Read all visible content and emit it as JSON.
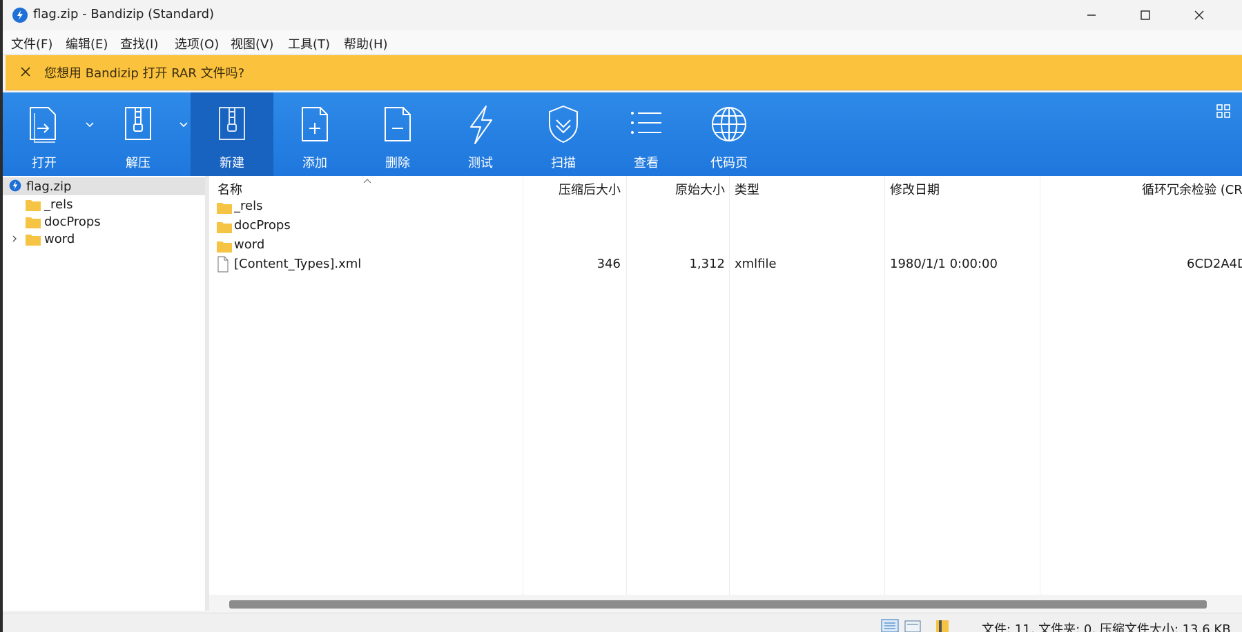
{
  "window": {
    "title": "flag.zip - Bandizip (Standard)"
  },
  "menu": [
    "文件(F)",
    "编辑(E)",
    "查找(I)",
    "选项(O)",
    "视图(V)",
    "工具(T)",
    "帮助(H)"
  ],
  "notice": {
    "text": "您想用 Bandizip 打开 RAR 文件吗?"
  },
  "toolbar": {
    "buttons": [
      {
        "label": "打开",
        "icon": "open-icon"
      },
      {
        "label": "解压",
        "icon": "extract-icon"
      },
      {
        "label": "新建",
        "icon": "new-archive-icon"
      },
      {
        "label": "添加",
        "icon": "add-file-icon"
      },
      {
        "label": "删除",
        "icon": "delete-file-icon"
      },
      {
        "label": "测试",
        "icon": "test-lightning-icon"
      },
      {
        "label": "扫描",
        "icon": "scan-shield-icon"
      },
      {
        "label": "查看",
        "icon": "view-list-icon"
      },
      {
        "label": "代码页",
        "icon": "codepage-globe-icon"
      }
    ],
    "active": "新建"
  },
  "tree": {
    "root": "flag.zip",
    "children": [
      "_rels",
      "docProps",
      "word"
    ]
  },
  "list": {
    "columns": [
      "名称",
      "压缩后大小",
      "原始大小",
      "类型",
      "修改日期",
      "循环冗余检验 (CR"
    ],
    "rows": [
      {
        "name": "_rels",
        "packed": "",
        "size": "",
        "type": "",
        "date": "",
        "crc": "",
        "kind": "folder"
      },
      {
        "name": "docProps",
        "packed": "",
        "size": "",
        "type": "",
        "date": "",
        "crc": "",
        "kind": "folder"
      },
      {
        "name": "word",
        "packed": "",
        "size": "",
        "type": "",
        "date": "",
        "crc": "",
        "kind": "folder"
      },
      {
        "name": "[Content_Types].xml",
        "packed": "346",
        "size": "1,312",
        "type": "xmlfile",
        "date": "1980/1/1 0:00:00",
        "crc": "6CD2A4D",
        "kind": "file"
      }
    ]
  },
  "status": {
    "text": "文件: 11, 文件夹: 0, 压缩文件大小: 13.6 KB"
  },
  "colors": {
    "toolbar": "#2483e3",
    "toolbar_active": "#1862c0",
    "notice": "#fbc23d",
    "folder": "#f6c445"
  }
}
